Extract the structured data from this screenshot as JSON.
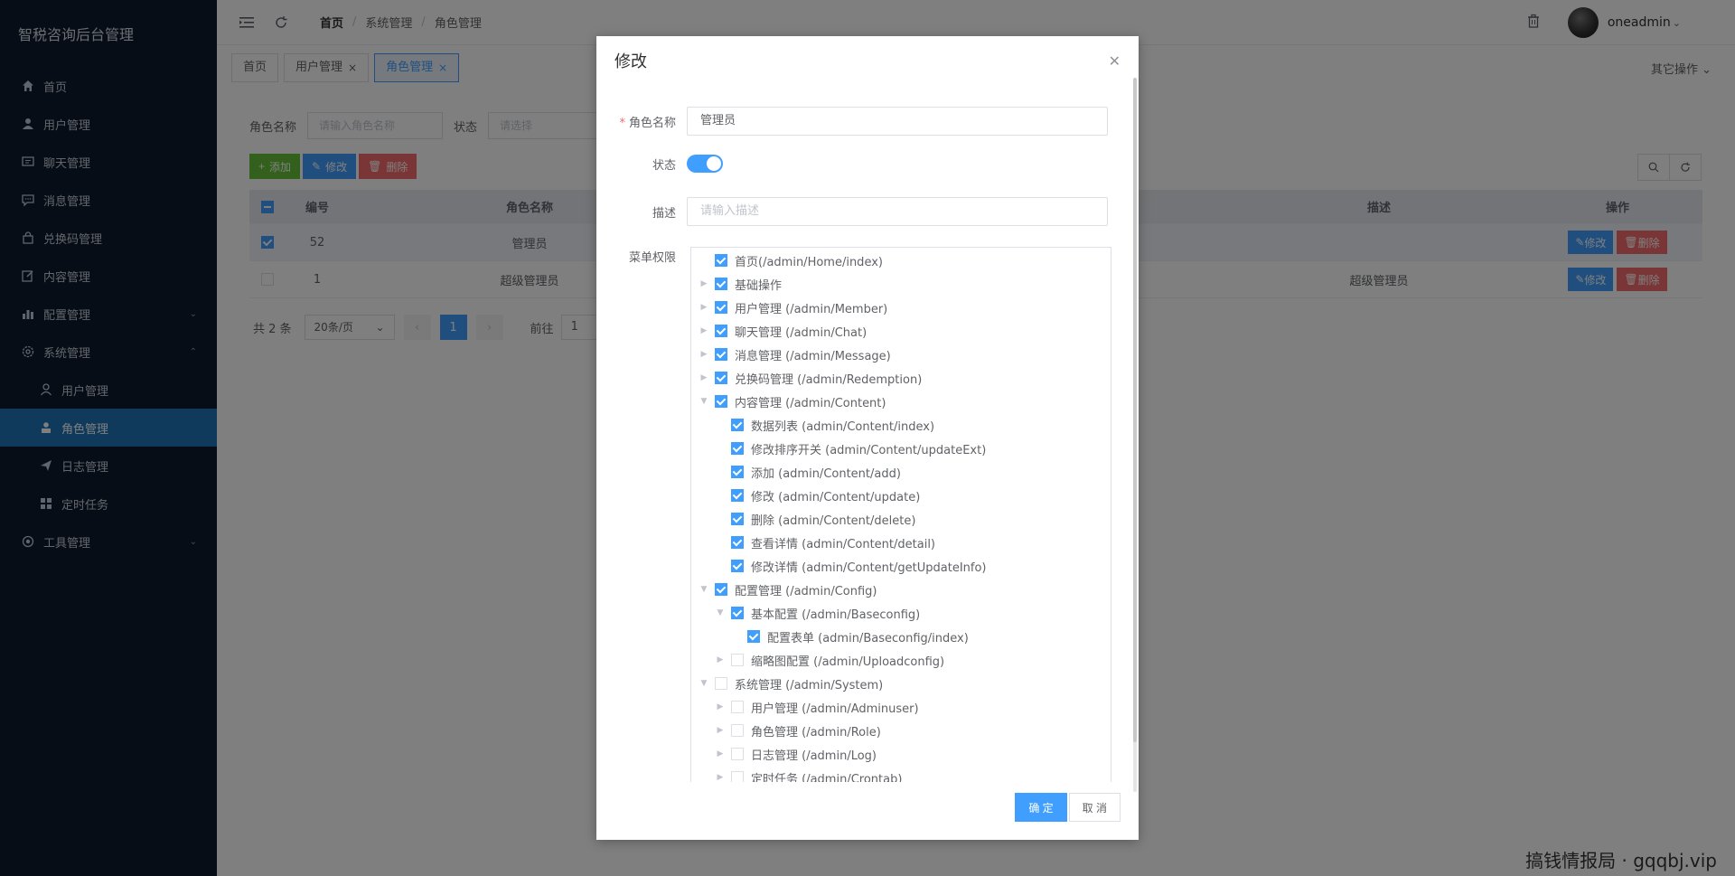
{
  "app": {
    "title": "智税咨询后台管理"
  },
  "sidebar": {
    "items": [
      {
        "label": "首页",
        "icon": "home-icon"
      },
      {
        "label": "用户管理",
        "icon": "user-icon"
      },
      {
        "label": "聊天管理",
        "icon": "chat-icon"
      },
      {
        "label": "消息管理",
        "icon": "message-icon"
      },
      {
        "label": "兑换码管理",
        "icon": "bag-icon"
      },
      {
        "label": "内容管理",
        "icon": "edit-icon"
      },
      {
        "label": "配置管理",
        "icon": "chart-icon"
      },
      {
        "label": "系统管理",
        "icon": "gear-icon"
      },
      {
        "label": "用户管理",
        "icon": "user-icon"
      },
      {
        "label": "角色管理",
        "icon": "role-icon"
      },
      {
        "label": "日志管理",
        "icon": "send-icon"
      },
      {
        "label": "定时任务",
        "icon": "grid-icon"
      },
      {
        "label": "工具管理",
        "icon": "tool-icon"
      }
    ]
  },
  "header": {
    "breadcrumb": [
      "首页",
      "系统管理",
      "角色管理"
    ],
    "username": "oneadmin"
  },
  "tabs": [
    {
      "label": "首页"
    },
    {
      "label": "用户管理"
    },
    {
      "label": "角色管理"
    }
  ],
  "other_ops": "其它操作",
  "filter": {
    "role_name_label": "角色名称",
    "role_name_placeholder": "请输入角色名称",
    "status_label": "状态",
    "status_placeholder": "请选择"
  },
  "toolbar": {
    "add": "添加",
    "edit": "修改",
    "delete": "删除"
  },
  "table": {
    "headers": {
      "id": "编号",
      "name": "角色名称",
      "desc": "描述",
      "op": "操作"
    },
    "rows": [
      {
        "id": "52",
        "name": "管理员",
        "desc": ""
      },
      {
        "id": "1",
        "name": "超级管理员",
        "desc": "超级管理员"
      }
    ],
    "edit": "修改",
    "delete": "删除"
  },
  "pager": {
    "total": "共 2 条",
    "size": "20条/页",
    "page": "1",
    "goto": "前往",
    "goto_value": "1"
  },
  "modal": {
    "title": "修改",
    "role_name_label": "角色名称",
    "role_name_value": "管理员",
    "status_label": "状态",
    "desc_label": "描述",
    "desc_placeholder": "请输入描述",
    "menu_label": "菜单权限",
    "confirm": "确 定",
    "cancel": "取 消",
    "tree": [
      {
        "label": "首页(/admin/Home/index)",
        "level": 0,
        "caret": "none",
        "checked": true
      },
      {
        "label": "基础操作",
        "level": 0,
        "caret": "right",
        "checked": true
      },
      {
        "label": "用户管理 (/admin/Member)",
        "level": 0,
        "caret": "right",
        "checked": true
      },
      {
        "label": "聊天管理 (/admin/Chat)",
        "level": 0,
        "caret": "right",
        "checked": true
      },
      {
        "label": "消息管理 (/admin/Message)",
        "level": 0,
        "caret": "right",
        "checked": true
      },
      {
        "label": "兑换码管理 (/admin/Redemption)",
        "level": 0,
        "caret": "right",
        "checked": true
      },
      {
        "label": "内容管理 (/admin/Content)",
        "level": 0,
        "caret": "down",
        "checked": true
      },
      {
        "label": "数据列表 (admin/Content/index)",
        "level": 1,
        "caret": "none",
        "checked": true
      },
      {
        "label": "修改排序开关 (admin/Content/updateExt)",
        "level": 1,
        "caret": "none",
        "checked": true
      },
      {
        "label": "添加 (admin/Content/add)",
        "level": 1,
        "caret": "none",
        "checked": true
      },
      {
        "label": "修改 (admin/Content/update)",
        "level": 1,
        "caret": "none",
        "checked": true
      },
      {
        "label": "删除 (admin/Content/delete)",
        "level": 1,
        "caret": "none",
        "checked": true
      },
      {
        "label": "查看详情 (admin/Content/detail)",
        "level": 1,
        "caret": "none",
        "checked": true
      },
      {
        "label": "修改详情 (admin/Content/getUpdateInfo)",
        "level": 1,
        "caret": "none",
        "checked": true
      },
      {
        "label": "配置管理 (/admin/Config)",
        "level": 0,
        "caret": "down",
        "checked": true
      },
      {
        "label": "基本配置 (/admin/Baseconfig)",
        "level": 1,
        "caret": "down",
        "checked": true
      },
      {
        "label": "配置表单 (admin/Baseconfig/index)",
        "level": 2,
        "caret": "none",
        "checked": true
      },
      {
        "label": "缩略图配置 (/admin/Uploadconfig)",
        "level": 1,
        "caret": "right",
        "checked": false
      },
      {
        "label": "系统管理 (/admin/System)",
        "level": 0,
        "caret": "down",
        "checked": false
      },
      {
        "label": "用户管理 (/admin/Adminuser)",
        "level": 1,
        "caret": "right",
        "checked": false
      },
      {
        "label": "角色管理 (/admin/Role)",
        "level": 1,
        "caret": "right",
        "checked": false
      },
      {
        "label": "日志管理 (/admin/Log)",
        "level": 1,
        "caret": "right",
        "checked": false
      },
      {
        "label": "定时任务 (/admin/Crontab)",
        "level": 1,
        "caret": "right",
        "checked": false
      }
    ]
  },
  "watermark": "搞钱情报局 · gqqbj.vip"
}
